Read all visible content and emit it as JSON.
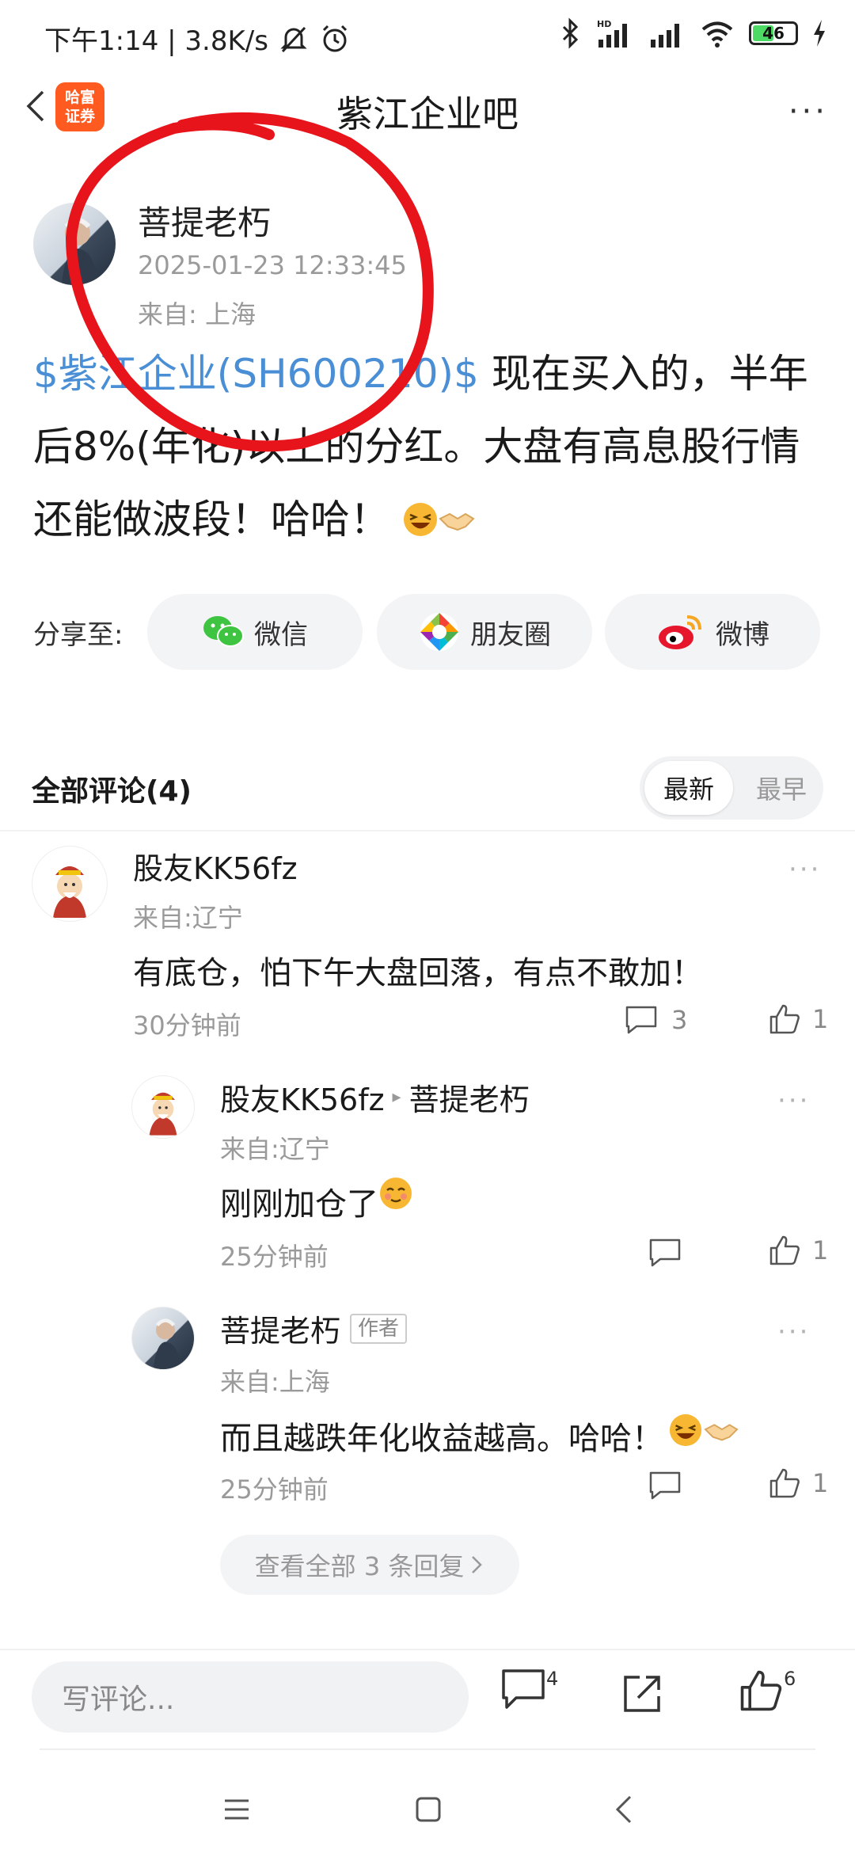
{
  "status_bar": {
    "time_speed": "下午1:14 | 3.8K/s",
    "battery": "46",
    "signal_label": "HD"
  },
  "header": {
    "logo_line1": "哈富",
    "logo_line2": "证券",
    "title": "紫江企业吧"
  },
  "post": {
    "author": "菩提老朽",
    "timestamp": "2025-01-23 12:33:45",
    "location": "来自: 上海",
    "stock_tag": "$紫江企业(SH600210)$",
    "text": " 现在买入的，半年后8%(年化)以上的分红。大盘有高息股行情还能做波段！哈哈！"
  },
  "share": {
    "label": "分享至:",
    "wechat": "微信",
    "moments": "朋友圈",
    "weibo": "微博"
  },
  "comments_section": {
    "title": "全部评论(4)",
    "sort_latest": "最新",
    "sort_earliest": "最早"
  },
  "comments": [
    {
      "name": "股友KK56fz",
      "location": "来自:辽宁",
      "text": "有底仓，怕下午大盘回落，有点不敢加！",
      "time": "30分钟前",
      "reply_count": "3",
      "like_count": "1"
    }
  ],
  "replies": [
    {
      "name": "股友KK56fz",
      "reply_to": "菩提老朽",
      "location": "来自:辽宁",
      "text": "刚刚加仓了",
      "time": "25分钟前",
      "like_count": "1"
    },
    {
      "name": "菩提老朽",
      "tag": "作者",
      "location": "来自:上海",
      "text": "而且越跌年化收益越高。哈哈！",
      "time": "25分钟前",
      "like_count": "1"
    }
  ],
  "view_all_replies": "查看全部 3 条回复 ",
  "bottom_bar": {
    "input_placeholder": "写评论...",
    "comment_count": "4",
    "like_count": "6"
  },
  "colors": {
    "link": "#4a8fd6",
    "logo_bg": "#ff5a1f",
    "annotation": "#e8141b"
  }
}
